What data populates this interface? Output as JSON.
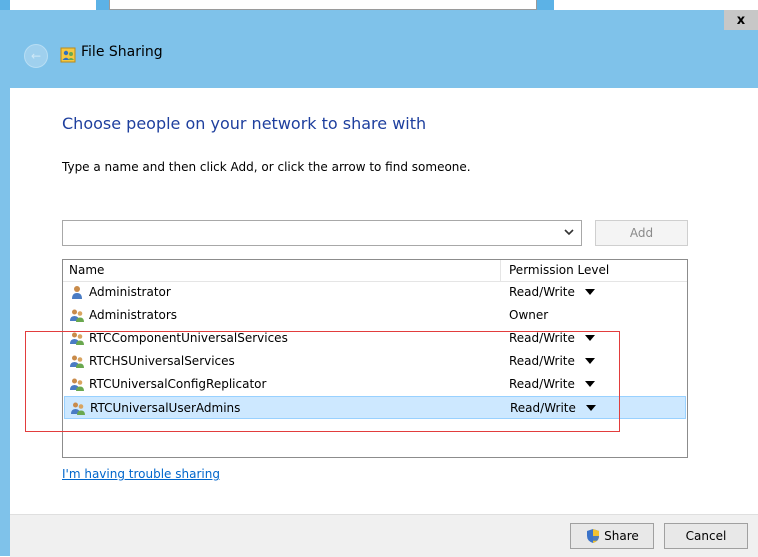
{
  "window": {
    "title": "File Sharing",
    "close_glyph": "x"
  },
  "main": {
    "heading": "Choose people on your network to share with",
    "instruction": "Type a name and then click Add, or click the arrow to find someone.",
    "name_input": {
      "value": "",
      "placeholder": ""
    },
    "add_label": "Add",
    "columns": {
      "name": "Name",
      "permission": "Permission Level"
    },
    "entries": [
      {
        "name": "Administrator",
        "permission": "Read/Write",
        "icon": "user-icon",
        "has_dropdown": true,
        "selected": false
      },
      {
        "name": "Administrators",
        "permission": "Owner",
        "icon": "group-icon",
        "has_dropdown": false,
        "selected": false
      },
      {
        "name": "RTCComponentUniversalServices",
        "permission": "Read/Write",
        "icon": "group-icon",
        "has_dropdown": true,
        "selected": false
      },
      {
        "name": "RTCHSUniversalServices",
        "permission": "Read/Write",
        "icon": "group-icon",
        "has_dropdown": true,
        "selected": false
      },
      {
        "name": "RTCUniversalConfigReplicator",
        "permission": "Read/Write",
        "icon": "group-icon",
        "has_dropdown": true,
        "selected": false
      },
      {
        "name": "RTCUniversalUserAdmins",
        "permission": "Read/Write",
        "icon": "group-icon",
        "has_dropdown": true,
        "selected": true
      }
    ],
    "help_link": "I'm having trouble sharing"
  },
  "footer": {
    "share_label": "Share",
    "cancel_label": "Cancel"
  },
  "colors": {
    "chrome": "#7fc2ea",
    "heading": "#1e3f9e",
    "link": "#0066cc",
    "selection": "#cde8ff",
    "annotation": "#e23d3d"
  }
}
